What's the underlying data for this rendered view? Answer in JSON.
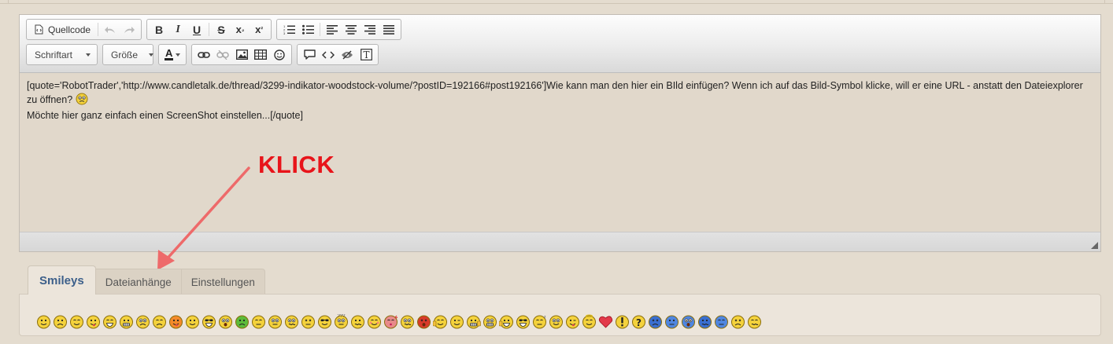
{
  "toolbar": {
    "source_label": "Quellcode",
    "font_label": "Schriftart",
    "size_label": "Größe",
    "color_label": "A"
  },
  "content": {
    "line1": "[quote='RobotTrader','http://www.candletalk.de/thread/3299-indikator-woodstock-volume/?postID=192166#post192166']Wie kann man den hier ein BIld einfügen? Wenn ich auf das Bild-Symbol klicke, will er eine URL - anstatt den Dateiexplorer zu öffnen?",
    "line2": "Möchte hier ganz einfach einen ScreenShot einstellen...[/quote]"
  },
  "annotation": {
    "text": "KLICK",
    "color": "#e8141a"
  },
  "tabs": [
    {
      "label": "Smileys",
      "active": true
    },
    {
      "label": "Dateianhänge",
      "active": false
    },
    {
      "label": "Einstellungen",
      "active": false
    }
  ],
  "colors": {
    "accent": "#3c5f8a",
    "smiley_yellow": "#f4d23c",
    "arrow": "#ee6a6a"
  },
  "smileys": [
    "smile-icon",
    "sad-icon",
    "meh-icon",
    "tongue-icon",
    "grin-icon",
    "biggrin-icon",
    "worried-icon",
    "annoyed-icon",
    "red-face-icon",
    "pleased-icon",
    "laugh-icon",
    "surprised-icon",
    "sick-icon",
    "neutral-icon",
    "rolling-icon",
    "confused-icon",
    "dead-icon",
    "cool-icon",
    "question-marks-icon",
    "unsure-icon",
    "blush-icon",
    "kiss-icon",
    "squint-icon",
    "angry-icon",
    "thumbs-icon",
    "wink-icon",
    "thumbs-up-icon",
    "crazy-icon",
    "thumbs-up-2-icon",
    "cool-thumbs-icon",
    "sleep-icon",
    "eyeroll-icon",
    "wink-2-icon",
    "angel-icon",
    "heart-icon",
    "exclamation-icon",
    "question-icon",
    "blue-cry-icon",
    "blue-smile-icon",
    "blue-happy-icon",
    "blue-sad-icon",
    "blue-neutral-icon",
    "dead-2-icon",
    "dizzy-icon"
  ]
}
